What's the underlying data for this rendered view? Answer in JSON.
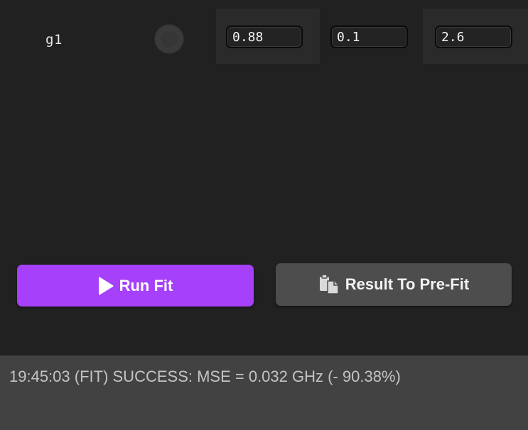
{
  "param": {
    "name": "g1",
    "values": [
      "0.88",
      "0.1",
      "2.6"
    ]
  },
  "actions": {
    "run_fit_label": "Run Fit",
    "run_fit_icon": "play-icon",
    "result_to_prefit_label": "Result To Pre-Fit",
    "result_to_prefit_icon": "clipboard-icon"
  },
  "status": {
    "message": "19:45:03 (FIT) SUCCESS: MSE = 0.032 GHz (- 90.38%)"
  },
  "colors": {
    "background": "#212121",
    "run_fit_button": "#a640fb",
    "secondary_button": "#4d4d4d",
    "status_bar": "#424242"
  }
}
